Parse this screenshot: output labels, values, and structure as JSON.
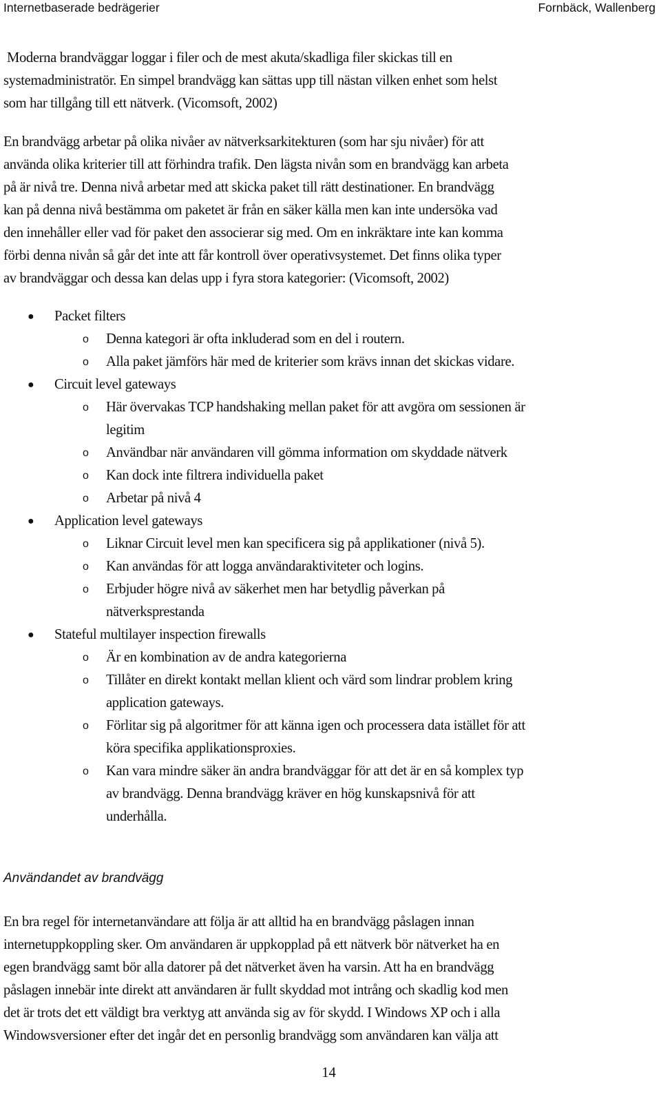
{
  "header": {
    "left": "Internetbaserade bedrägerier",
    "right": "Fornbäck, Wallenberg"
  },
  "paragraphs": {
    "p1": [
      "Moderna brandväggar loggar i filer och de mest akuta/skadliga filer skickas till en",
      "systemadministratör. En simpel brandvägg kan sättas upp till nästan vilken enhet som helst",
      "som har tillgång till ett nätverk. (Vicomsoft, 2002)"
    ],
    "p2": [
      "En brandvägg arbetar på olika nivåer av nätverksarkitekturen (som har sju nivåer) för att",
      "använda olika kriterier till att förhindra trafik. Den lägsta nivån som en brandvägg kan arbeta",
      "på är nivå tre. Denna nivå arbetar med att skicka paket till rätt destinationer. En brandvägg",
      "kan på denna nivå bestämma om paketet är från en säker källa men kan inte undersöka vad",
      "den innehåller eller vad för paket den associerar sig med. Om en inkräktare inte kan komma",
      "förbi denna nivån så går det inte att får kontroll över operativsystemet. Det finns olika typer",
      "av brandväggar och dessa kan delas upp i fyra stora kategorier: (Vicomsoft, 2002)"
    ],
    "p3": [
      "En bra regel för internetanvändare att följa är att alltid ha en brandvägg påslagen innan",
      "internetuppkoppling sker. Om användaren är uppkopplad på ett nätverk bör nätverket ha en",
      "egen brandvägg samt bör alla datorer på det nätverket även ha varsin. Att ha en brandvägg",
      "påslagen innebär inte direkt att användaren är fullt skyddad mot intrång och skadlig kod men",
      "det är trots det ett väldigt bra verktyg att använda sig av för skydd. I Windows XP och i alla",
      "Windowsversioner efter det ingår det en personlig brandvägg som användaren kan välja att"
    ]
  },
  "list": {
    "bullet_marker": "●",
    "sub_marker": "o",
    "items": [
      {
        "label": "Packet filters",
        "sub": [
          [
            "Denna kategori är ofta inkluderad som en del i routern."
          ],
          [
            "Alla paket jämförs här med de kriterier som krävs innan det skickas vidare."
          ]
        ]
      },
      {
        "label": "Circuit level gateways",
        "sub": [
          [
            "Här övervakas TCP handshaking mellan paket för att avgöra om sessionen är",
            "legitim"
          ],
          [
            "Användbar när användaren vill gömma information om skyddade nätverk"
          ],
          [
            "Kan dock inte filtrera individuella paket"
          ],
          [
            "Arbetar på nivå 4"
          ]
        ]
      },
      {
        "label": "Application level gateways",
        "sub": [
          [
            "Liknar Circuit level men kan specificera sig på applikationer (nivå 5)."
          ],
          [
            "Kan användas för att logga användaraktiviteter och logins."
          ],
          [
            "Erbjuder högre nivå av säkerhet men har betydlig påverkan på",
            "nätverksprestanda"
          ]
        ]
      },
      {
        "label": "Stateful multilayer inspection firewalls",
        "sub": [
          [
            "Är en kombination av de andra kategorierna"
          ],
          [
            "Tillåter en direkt kontakt mellan klient och värd som lindrar problem kring",
            "application gateways."
          ],
          [
            "Förlitar sig på algoritmer för att känna igen och processera data istället för att",
            "köra specifika applikationsproxies."
          ],
          [
            "Kan vara mindre säker än andra brandväggar för att det är en så komplex typ",
            "av brandvägg. Denna brandvägg kräver en hög kunskapsnivå för att",
            "underhålla."
          ]
        ]
      }
    ]
  },
  "section_heading": "Användandet av brandvägg",
  "page_number": "14"
}
